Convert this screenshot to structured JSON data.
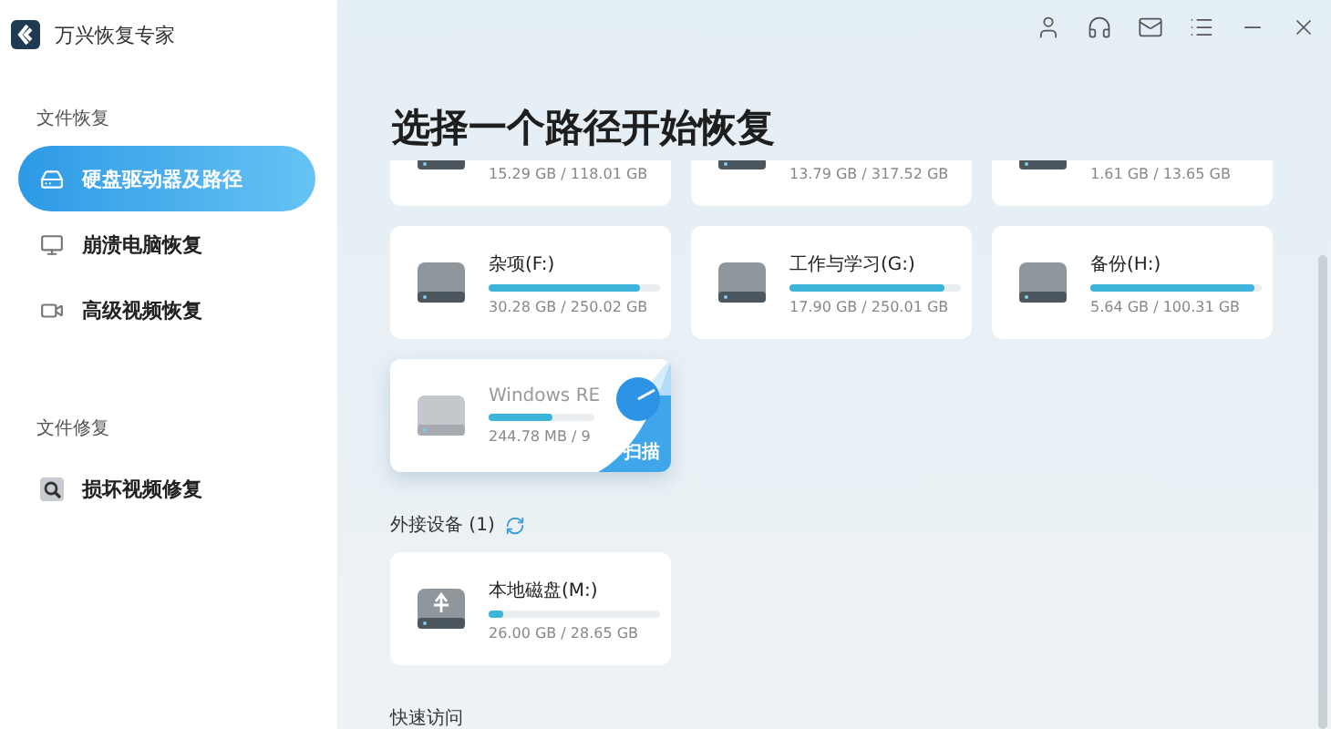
{
  "app": {
    "title": "万兴恢复专家"
  },
  "window_controls": [
    {
      "kind": "user"
    },
    {
      "kind": "support"
    },
    {
      "kind": "mail"
    },
    {
      "kind": "menu"
    },
    {
      "kind": "minimize"
    },
    {
      "kind": "close"
    }
  ],
  "sidebar": {
    "sections": [
      {
        "heading": "文件恢复",
        "items": [
          {
            "label": "硬盘驱动器及路径",
            "selected": true
          },
          {
            "label": "崩溃电脑恢复",
            "selected": false
          },
          {
            "label": "高级视频恢复",
            "selected": false
          }
        ]
      },
      {
        "heading": "文件修复",
        "items": [
          {
            "label": "损坏视频修复",
            "selected": false
          }
        ]
      }
    ]
  },
  "main": {
    "title": "选择一个路径开始恢复",
    "drives": [
      {
        "kind": "clipped",
        "size": "15.29 GB / 118.01 GB"
      },
      {
        "kind": "clipped",
        "size": "13.79 GB / 317.52 GB"
      },
      {
        "kind": "clipped",
        "size": "1.61 GB / 13.65 GB"
      },
      {
        "kind": "full",
        "name": "杂项(F:)",
        "size": "30.28 GB / 250.02 GB",
        "level": 0.88
      },
      {
        "kind": "full",
        "name": "工作与学习(G:)",
        "size": "17.90 GB / 250.01 GB",
        "level": 0.9
      },
      {
        "kind": "full",
        "name": "备份(H:)",
        "size": "5.64 GB / 100.31 GB",
        "level": 0.96
      },
      {
        "kind": "hover",
        "name": "Windows RE",
        "size": "244.78 MB / 9",
        "level": 0.6,
        "action": "扫描"
      }
    ],
    "external": {
      "heading": "外接设备 (1)",
      "drives": [
        {
          "kind": "usb",
          "name": "本地磁盘(M:)",
          "size": "26.00 GB / 28.65 GB",
          "level": 0.08
        }
      ]
    },
    "quick_access": {
      "heading": "快速访问"
    }
  }
}
